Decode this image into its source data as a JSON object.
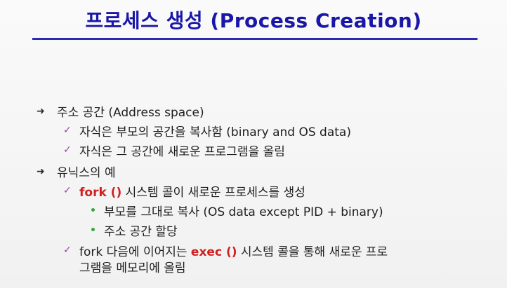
{
  "title": "프로세스 생성 (Process Creation)",
  "items": [
    {
      "text": "주소 공간 (Address space)"
    },
    {
      "text": "자식은 부모의 공간을 복사함 (binary and OS data)"
    },
    {
      "text": "자식은 그 공간에 새로운 프로그램을 올림"
    },
    {
      "text": "유닉스의 예"
    },
    {
      "prefix": "fork ()",
      "text": " 시스템 콜이 새로운 프로세스를 생성"
    },
    {
      "text": "부모를 그대로 복사 (OS data except PID  +  binary)"
    },
    {
      "text": "주소 공간 할당"
    },
    {
      "text_a": "fork 다음에 이어지는 ",
      "highlight": "exec ()",
      "text_b": " 시스템 콜을 통해 새로운 프로",
      "line2": "그램을 메모리에 올림"
    }
  ],
  "colors": {
    "title": "#1a17a8",
    "rule": "#2b2ab2",
    "highlight": "#d12020",
    "check": "#9b3fa8",
    "dot": "#3aa63a"
  }
}
